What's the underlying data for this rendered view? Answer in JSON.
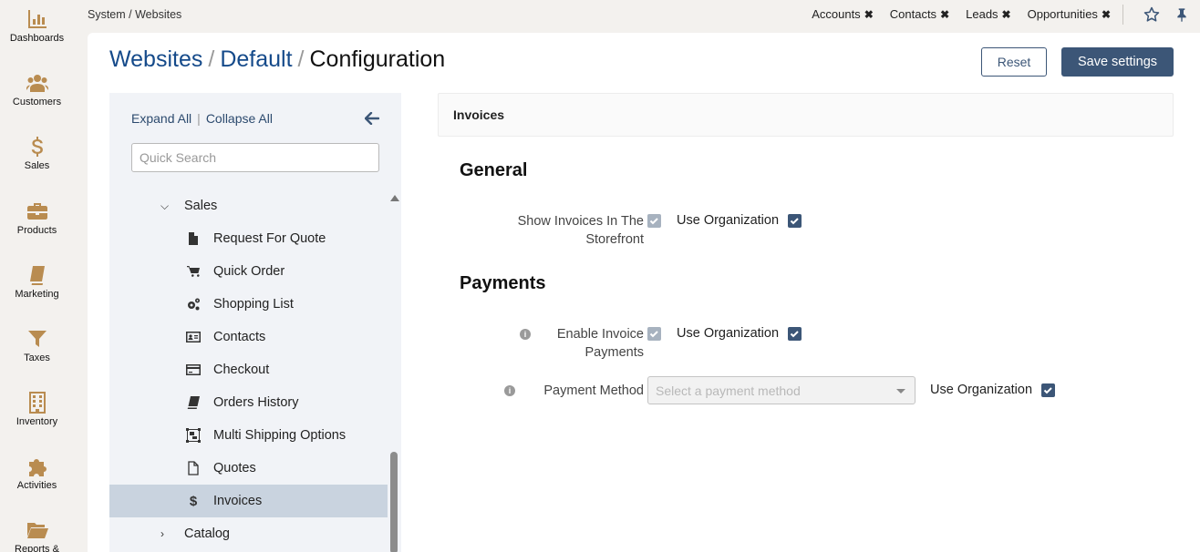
{
  "rail": [
    {
      "label": "Dashboards",
      "icon": "chart-bar-icon"
    },
    {
      "label": "Customers",
      "icon": "users-icon"
    },
    {
      "label": "Sales",
      "icon": "dollar-icon"
    },
    {
      "label": "Products",
      "icon": "briefcase-icon"
    },
    {
      "label": "Marketing",
      "icon": "book-icon"
    },
    {
      "label": "Taxes",
      "icon": "filter-icon"
    },
    {
      "label": "Inventory",
      "icon": "building-icon"
    },
    {
      "label": "Activities",
      "icon": "puzzle-icon"
    },
    {
      "label": "Reports &",
      "icon": "folder-open-icon"
    }
  ],
  "topbar": {
    "breadcrumb": "System / Websites",
    "favorites": [
      "Accounts",
      "Contacts",
      "Leads",
      "Opportunities"
    ]
  },
  "header": {
    "title_parts": [
      "Websites",
      "Default",
      "Configuration"
    ],
    "reset_label": "Reset",
    "save_label": "Save settings"
  },
  "tree": {
    "expand_all": "Expand All",
    "collapse_all": "Collapse All",
    "search_placeholder": "Quick Search",
    "items": [
      {
        "label": "Sales",
        "type": "group",
        "expanded": true
      },
      {
        "label": "Request For Quote",
        "icon": "file-icon"
      },
      {
        "label": "Quick Order",
        "icon": "cart-icon"
      },
      {
        "label": "Shopping List",
        "icon": "gears-icon"
      },
      {
        "label": "Contacts",
        "icon": "id-card-icon"
      },
      {
        "label": "Checkout",
        "icon": "credit-card-icon"
      },
      {
        "label": "Orders History",
        "icon": "book-icon"
      },
      {
        "label": "Multi Shipping Options",
        "icon": "object-group-icon"
      },
      {
        "label": "Quotes",
        "icon": "file-outline-icon"
      },
      {
        "label": "Invoices",
        "icon": "dollar-icon",
        "active": true
      },
      {
        "label": "Catalog",
        "type": "group",
        "expanded": false
      }
    ]
  },
  "content": {
    "section_title": "Invoices",
    "groups": [
      {
        "title": "General",
        "fields": [
          {
            "label_lines": [
              "Show Invoices In The",
              "Storefront"
            ],
            "use_org_label": "Use Organization"
          }
        ]
      },
      {
        "title": "Payments",
        "fields": [
          {
            "label_lines": [
              "Enable Invoice",
              "Payments"
            ],
            "use_org_label": "Use Organization",
            "info": true
          },
          {
            "label_lines": [
              "Payment Method"
            ],
            "select_placeholder": "Select a payment method",
            "use_org_label": "Use Organization",
            "info": true
          }
        ]
      }
    ]
  },
  "colors": {
    "accent": "#3c5677",
    "link": "#154a8a",
    "rail_icon": "#b98c50",
    "tree_active": "#c9d3df"
  }
}
